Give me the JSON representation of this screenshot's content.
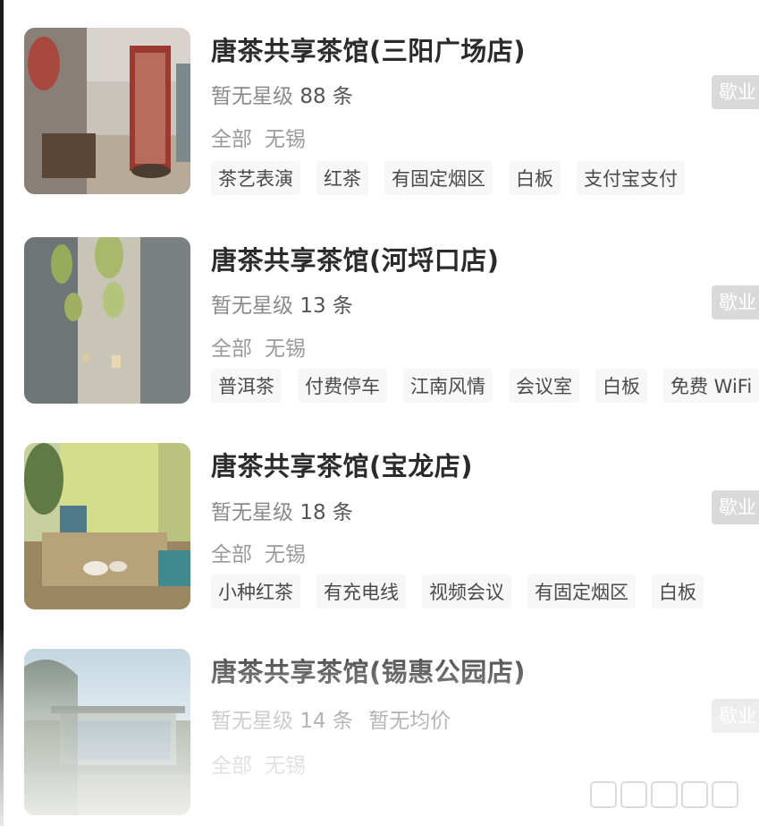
{
  "shops": [
    {
      "name": "唐茶共享茶馆(三阳广场店)",
      "rating": "暂无星级",
      "reviews": "88 条",
      "avg_price": "",
      "category": "全部",
      "city": "无锡",
      "type_badge": "歇业",
      "tags": [
        "茶艺表演",
        "红茶",
        "有固定烟区",
        "白板",
        "支付宝支付"
      ],
      "image": "interior-red-screen"
    },
    {
      "name": "唐茶共享茶馆(河埒口店)",
      "rating": "暂无星级",
      "reviews": "13 条",
      "avg_price": "",
      "category": "全部",
      "city": "无锡",
      "type_badge": "歇业",
      "tags": [
        "普洱茶",
        "付费停车",
        "江南风情",
        "会议室",
        "白板",
        "免费 WiFi"
      ],
      "image": "corridor-leaf-lamps"
    },
    {
      "name": "唐茶共享茶馆(宝龙店)",
      "rating": "暂无星级",
      "reviews": "18 条",
      "avg_price": "",
      "category": "全部",
      "city": "无锡",
      "type_badge": "歇业",
      "tags": [
        "小种红茶",
        "有充电线",
        "视频会议",
        "有固定烟区",
        "白板"
      ],
      "image": "tea-table-green"
    },
    {
      "name": "唐茶共享茶馆(锡惠公园店)",
      "rating": "暂无星级",
      "reviews": "14 条",
      "avg_price": "暂无均价",
      "category": "全部",
      "city": "无锡",
      "type_badge": "歇业",
      "tags": [],
      "image": "pavilion-exterior"
    }
  ]
}
